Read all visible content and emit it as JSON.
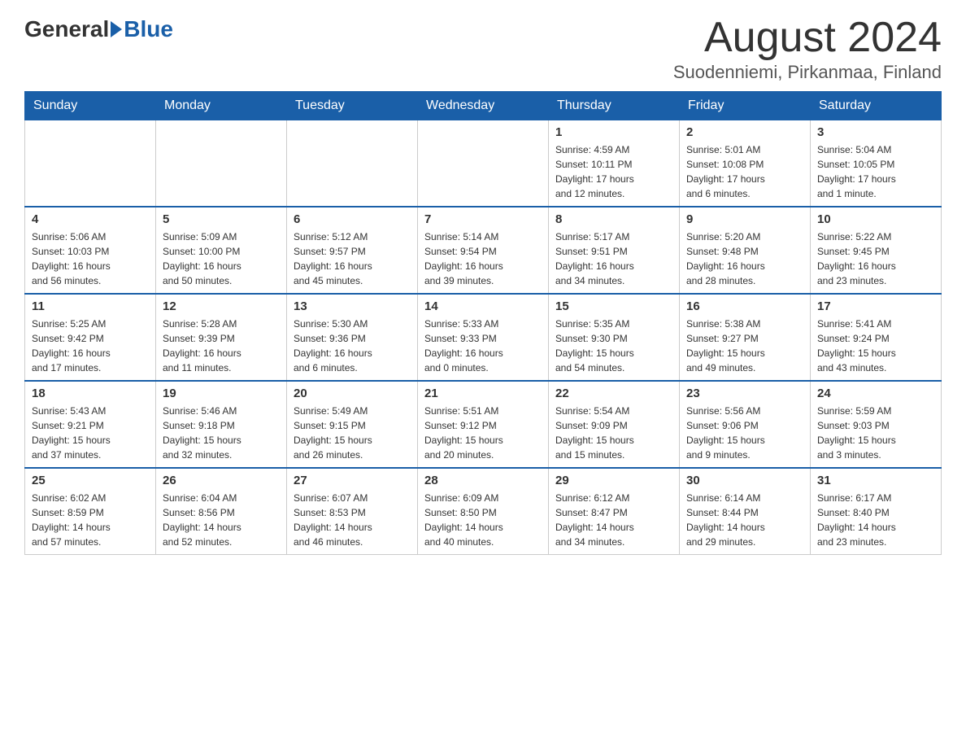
{
  "header": {
    "logo_text_general": "General",
    "logo_text_blue": "Blue",
    "month_title": "August 2024",
    "location": "Suodenniemi, Pirkanmaa, Finland"
  },
  "days_of_week": [
    "Sunday",
    "Monday",
    "Tuesday",
    "Wednesday",
    "Thursday",
    "Friday",
    "Saturday"
  ],
  "weeks": [
    [
      {
        "day": "",
        "info": ""
      },
      {
        "day": "",
        "info": ""
      },
      {
        "day": "",
        "info": ""
      },
      {
        "day": "",
        "info": ""
      },
      {
        "day": "1",
        "info": "Sunrise: 4:59 AM\nSunset: 10:11 PM\nDaylight: 17 hours\nand 12 minutes."
      },
      {
        "day": "2",
        "info": "Sunrise: 5:01 AM\nSunset: 10:08 PM\nDaylight: 17 hours\nand 6 minutes."
      },
      {
        "day": "3",
        "info": "Sunrise: 5:04 AM\nSunset: 10:05 PM\nDaylight: 17 hours\nand 1 minute."
      }
    ],
    [
      {
        "day": "4",
        "info": "Sunrise: 5:06 AM\nSunset: 10:03 PM\nDaylight: 16 hours\nand 56 minutes."
      },
      {
        "day": "5",
        "info": "Sunrise: 5:09 AM\nSunset: 10:00 PM\nDaylight: 16 hours\nand 50 minutes."
      },
      {
        "day": "6",
        "info": "Sunrise: 5:12 AM\nSunset: 9:57 PM\nDaylight: 16 hours\nand 45 minutes."
      },
      {
        "day": "7",
        "info": "Sunrise: 5:14 AM\nSunset: 9:54 PM\nDaylight: 16 hours\nand 39 minutes."
      },
      {
        "day": "8",
        "info": "Sunrise: 5:17 AM\nSunset: 9:51 PM\nDaylight: 16 hours\nand 34 minutes."
      },
      {
        "day": "9",
        "info": "Sunrise: 5:20 AM\nSunset: 9:48 PM\nDaylight: 16 hours\nand 28 minutes."
      },
      {
        "day": "10",
        "info": "Sunrise: 5:22 AM\nSunset: 9:45 PM\nDaylight: 16 hours\nand 23 minutes."
      }
    ],
    [
      {
        "day": "11",
        "info": "Sunrise: 5:25 AM\nSunset: 9:42 PM\nDaylight: 16 hours\nand 17 minutes."
      },
      {
        "day": "12",
        "info": "Sunrise: 5:28 AM\nSunset: 9:39 PM\nDaylight: 16 hours\nand 11 minutes."
      },
      {
        "day": "13",
        "info": "Sunrise: 5:30 AM\nSunset: 9:36 PM\nDaylight: 16 hours\nand 6 minutes."
      },
      {
        "day": "14",
        "info": "Sunrise: 5:33 AM\nSunset: 9:33 PM\nDaylight: 16 hours\nand 0 minutes."
      },
      {
        "day": "15",
        "info": "Sunrise: 5:35 AM\nSunset: 9:30 PM\nDaylight: 15 hours\nand 54 minutes."
      },
      {
        "day": "16",
        "info": "Sunrise: 5:38 AM\nSunset: 9:27 PM\nDaylight: 15 hours\nand 49 minutes."
      },
      {
        "day": "17",
        "info": "Sunrise: 5:41 AM\nSunset: 9:24 PM\nDaylight: 15 hours\nand 43 minutes."
      }
    ],
    [
      {
        "day": "18",
        "info": "Sunrise: 5:43 AM\nSunset: 9:21 PM\nDaylight: 15 hours\nand 37 minutes."
      },
      {
        "day": "19",
        "info": "Sunrise: 5:46 AM\nSunset: 9:18 PM\nDaylight: 15 hours\nand 32 minutes."
      },
      {
        "day": "20",
        "info": "Sunrise: 5:49 AM\nSunset: 9:15 PM\nDaylight: 15 hours\nand 26 minutes."
      },
      {
        "day": "21",
        "info": "Sunrise: 5:51 AM\nSunset: 9:12 PM\nDaylight: 15 hours\nand 20 minutes."
      },
      {
        "day": "22",
        "info": "Sunrise: 5:54 AM\nSunset: 9:09 PM\nDaylight: 15 hours\nand 15 minutes."
      },
      {
        "day": "23",
        "info": "Sunrise: 5:56 AM\nSunset: 9:06 PM\nDaylight: 15 hours\nand 9 minutes."
      },
      {
        "day": "24",
        "info": "Sunrise: 5:59 AM\nSunset: 9:03 PM\nDaylight: 15 hours\nand 3 minutes."
      }
    ],
    [
      {
        "day": "25",
        "info": "Sunrise: 6:02 AM\nSunset: 8:59 PM\nDaylight: 14 hours\nand 57 minutes."
      },
      {
        "day": "26",
        "info": "Sunrise: 6:04 AM\nSunset: 8:56 PM\nDaylight: 14 hours\nand 52 minutes."
      },
      {
        "day": "27",
        "info": "Sunrise: 6:07 AM\nSunset: 8:53 PM\nDaylight: 14 hours\nand 46 minutes."
      },
      {
        "day": "28",
        "info": "Sunrise: 6:09 AM\nSunset: 8:50 PM\nDaylight: 14 hours\nand 40 minutes."
      },
      {
        "day": "29",
        "info": "Sunrise: 6:12 AM\nSunset: 8:47 PM\nDaylight: 14 hours\nand 34 minutes."
      },
      {
        "day": "30",
        "info": "Sunrise: 6:14 AM\nSunset: 8:44 PM\nDaylight: 14 hours\nand 29 minutes."
      },
      {
        "day": "31",
        "info": "Sunrise: 6:17 AM\nSunset: 8:40 PM\nDaylight: 14 hours\nand 23 minutes."
      }
    ]
  ]
}
